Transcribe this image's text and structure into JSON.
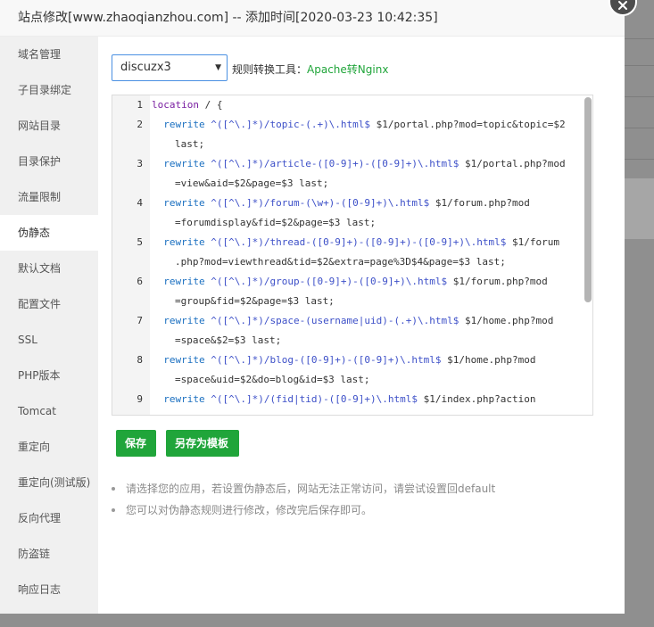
{
  "window": {
    "title": "站点修改[www.zhaoqianzhou.com] -- 添加时间[2020-03-23 10:42:35]"
  },
  "sidebar": {
    "items": [
      {
        "label": "域名管理"
      },
      {
        "label": "子目录绑定"
      },
      {
        "label": "网站目录"
      },
      {
        "label": "目录保护"
      },
      {
        "label": "流量限制"
      },
      {
        "label": "伪静态"
      },
      {
        "label": "默认文档"
      },
      {
        "label": "配置文件"
      },
      {
        "label": "SSL"
      },
      {
        "label": "PHP版本"
      },
      {
        "label": "Tomcat"
      },
      {
        "label": "重定向"
      },
      {
        "label": "重定向(测试版)"
      },
      {
        "label": "反向代理"
      },
      {
        "label": "防盗链"
      },
      {
        "label": "响应日志"
      }
    ],
    "active": "伪静态"
  },
  "rewrite": {
    "selected": "discuzx3",
    "tool_label": "规则转换工具：",
    "tool_link": "Apache转Nginx"
  },
  "editor": {
    "lines": [
      {
        "num": "1",
        "text": "location / {",
        "cont": ""
      },
      {
        "num": "2",
        "text": "  rewrite ^([^\\.]*)/topic-(.+)\\.html$ $1/portal.php?mod=topic&topic=$2",
        "cont": "last;"
      },
      {
        "num": "3",
        "text": "  rewrite ^([^\\.]*)/article-([0-9]+)-([0-9]+)\\.html$ $1/portal.php?mod",
        "cont": "=view&aid=$2&page=$3 last;"
      },
      {
        "num": "4",
        "text": "  rewrite ^([^\\.]*)/forum-(\\w+)-([0-9]+)\\.html$ $1/forum.php?mod",
        "cont": "=forumdisplay&fid=$2&page=$3 last;"
      },
      {
        "num": "5",
        "text": "  rewrite ^([^\\.]*)/thread-([0-9]+)-([0-9]+)-([0-9]+)\\.html$ $1/forum",
        "cont": ".php?mod=viewthread&tid=$2&extra=page%3D$4&page=$3 last;"
      },
      {
        "num": "6",
        "text": "  rewrite ^([^\\.]*)/group-([0-9]+)-([0-9]+)\\.html$ $1/forum.php?mod",
        "cont": "=group&fid=$2&page=$3 last;"
      },
      {
        "num": "7",
        "text": "  rewrite ^([^\\.]*)/space-(username|uid)-(.+)\\.html$ $1/home.php?mod",
        "cont": "=space&$2=$3 last;"
      },
      {
        "num": "8",
        "text": "  rewrite ^([^\\.]*)/blog-([0-9]+)-([0-9]+)\\.html$ $1/home.php?mod",
        "cont": "=space&uid=$2&do=blog&id=$3 last;"
      },
      {
        "num": "9",
        "text": "  rewrite ^([^\\.]*)/(fid|tid)-([0-9]+)\\.html$ $1/index.php?action",
        "cont": ""
      }
    ]
  },
  "buttons": {
    "save": "保存",
    "save_template": "另存为模板"
  },
  "tips": [
    "请选择您的应用，若设置伪静态后，网站无法正常访问，请尝试设置回default",
    "您可以对伪静态规则进行修改，修改完后保存即可。"
  ],
  "colors": {
    "accent": "#20a53a",
    "select_border": "#4a90e2"
  },
  "icons": {
    "close": "close-icon",
    "dropdown": "caret-down-icon"
  }
}
